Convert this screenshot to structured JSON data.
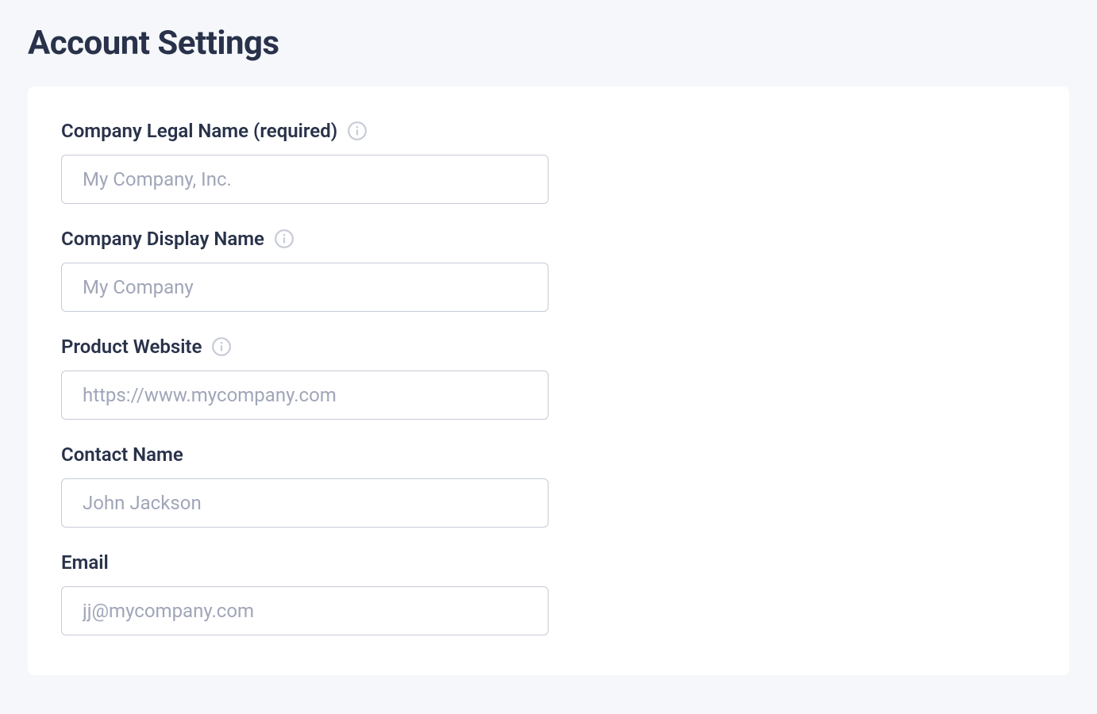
{
  "page": {
    "title": "Account Settings"
  },
  "form": {
    "fields": [
      {
        "id": "company-legal-name",
        "label": "Company Legal Name (required)",
        "placeholder": "My Company, Inc.",
        "has_info": true
      },
      {
        "id": "company-display-name",
        "label": "Company Display Name",
        "placeholder": "My Company",
        "has_info": true
      },
      {
        "id": "product-website",
        "label": "Product Website",
        "placeholder": "https://www.mycompany.com",
        "has_info": true
      },
      {
        "id": "contact-name",
        "label": "Contact Name",
        "placeholder": "John Jackson",
        "has_info": false
      },
      {
        "id": "email",
        "label": "Email",
        "placeholder": "jj@mycompany.com",
        "has_info": false
      }
    ]
  }
}
